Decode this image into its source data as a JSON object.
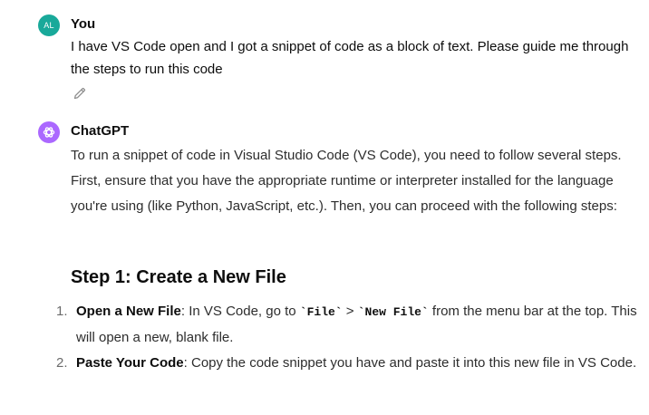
{
  "user": {
    "avatar_initials": "AL",
    "avatar_color": "#19a99a",
    "name": "You",
    "message": "I have VS Code open and I got a snippet of code as a block of text. Please guide me through the steps to run this code",
    "edit_icon": "pencil-icon"
  },
  "assistant": {
    "avatar_icon": "openai-logo-icon",
    "avatar_color": "#ab68ff",
    "name": "ChatGPT",
    "intro": "To run a snippet of code in Visual Studio Code (VS Code), you need to follow several steps. First, ensure that you have the appropriate runtime or interpreter installed for the language you're using (like Python, JavaScript, etc.). Then, you can proceed with the following steps:",
    "heading": "Step 1: Create a New File",
    "steps": [
      {
        "number": "1.",
        "title": "Open a New File",
        "text_a": ": In VS Code, go to ",
        "code_a": "`File`",
        "text_b": " > ",
        "code_b": "`New File`",
        "text_c": " from the menu bar at the top. This will open a new, blank file."
      },
      {
        "number": "2.",
        "title": "Paste Your Code",
        "text_a": ": Copy the code snippet you have and paste it into this new file in VS Code."
      }
    ]
  }
}
